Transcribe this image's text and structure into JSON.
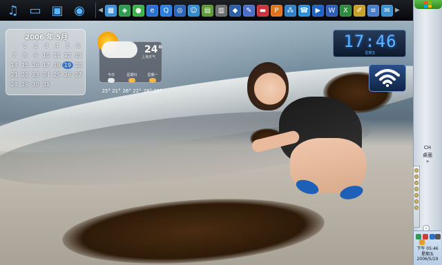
{
  "topbar": {
    "big_icons": [
      {
        "name": "music-icon",
        "glyph": "♫"
      },
      {
        "name": "picture-icon",
        "glyph": "▭"
      },
      {
        "name": "video-icon",
        "glyph": "▣"
      },
      {
        "name": "disc-icon",
        "glyph": "◉"
      }
    ],
    "quicklaunch": [
      {
        "name": "app-icon-1",
        "color": "#3a8ed8",
        "glyph": "▦"
      },
      {
        "name": "shield-icon",
        "color": "#2f9b4f",
        "glyph": "◈"
      },
      {
        "name": "chrome-ball-icon",
        "color": "#3bb34a",
        "glyph": "●"
      },
      {
        "name": "ie-icon",
        "color": "#2c6fd1",
        "glyph": "e"
      },
      {
        "name": "search-icon",
        "color": "#2a7fe0",
        "glyph": "Q"
      },
      {
        "name": "eye-icon",
        "color": "#2a63b8",
        "glyph": "◎"
      },
      {
        "name": "people-icon",
        "color": "#2f8ad0",
        "glyph": "☺"
      },
      {
        "name": "photo-app-icon",
        "color": "#5a9a2e",
        "glyph": "▤"
      },
      {
        "name": "printer-icon",
        "color": "#6a6a6a",
        "glyph": "▥"
      },
      {
        "name": "gem-icon",
        "color": "#2c5fa8",
        "glyph": "◆"
      },
      {
        "name": "tools-icon",
        "color": "#4b6fc9",
        "glyph": "✎"
      },
      {
        "name": "color-palette-icon",
        "color": "#c9353a",
        "glyph": "▬"
      },
      {
        "name": "p-app-icon",
        "color": "#e2731e",
        "glyph": "P"
      },
      {
        "name": "network-icon",
        "color": "#2f7fc8",
        "glyph": "⁂"
      },
      {
        "name": "chat-icon",
        "color": "#2c90d8",
        "glyph": "☎"
      },
      {
        "name": "media-player-icon",
        "color": "#1e62c4",
        "glyph": "▶"
      },
      {
        "name": "word-icon",
        "color": "#2b5cb8",
        "glyph": "W"
      },
      {
        "name": "excel-icon",
        "color": "#2e8a3a",
        "glyph": "X"
      },
      {
        "name": "pencils-icon",
        "color": "#c8a128",
        "glyph": "✐"
      },
      {
        "name": "document-icon",
        "color": "#4a7ec8",
        "glyph": "≡"
      },
      {
        "name": "notes-icon",
        "color": "#3a90d0",
        "glyph": "✉"
      }
    ]
  },
  "calendar": {
    "title": "2006 年 5月",
    "days": [
      "1",
      "2",
      "3",
      "4",
      "5",
      "6",
      "7",
      "8",
      "9",
      "10",
      "11",
      "12",
      "13",
      "14",
      "15",
      "16",
      "17",
      "18",
      "19",
      "20",
      "21",
      "22",
      "23",
      "24",
      "25",
      "26",
      "27",
      "28",
      "29",
      "30",
      "31"
    ],
    "today": "19"
  },
  "weather": {
    "temp": "24°",
    "place": "上海天气",
    "forecast": [
      {
        "label": "今日",
        "temp": "25° 21°"
      },
      {
        "label": "星期日",
        "temp": "26° 22°"
      },
      {
        "label": "星期一",
        "temp": "28° 22°"
      }
    ]
  },
  "clock": {
    "time": "17:46",
    "date": "星期五"
  },
  "sidebar": {
    "lang": "CH",
    "desk": "桌面",
    "arrow": "»",
    "time": "下午 05:46",
    "weekday": "星期五",
    "date": "2006/5/19"
  }
}
